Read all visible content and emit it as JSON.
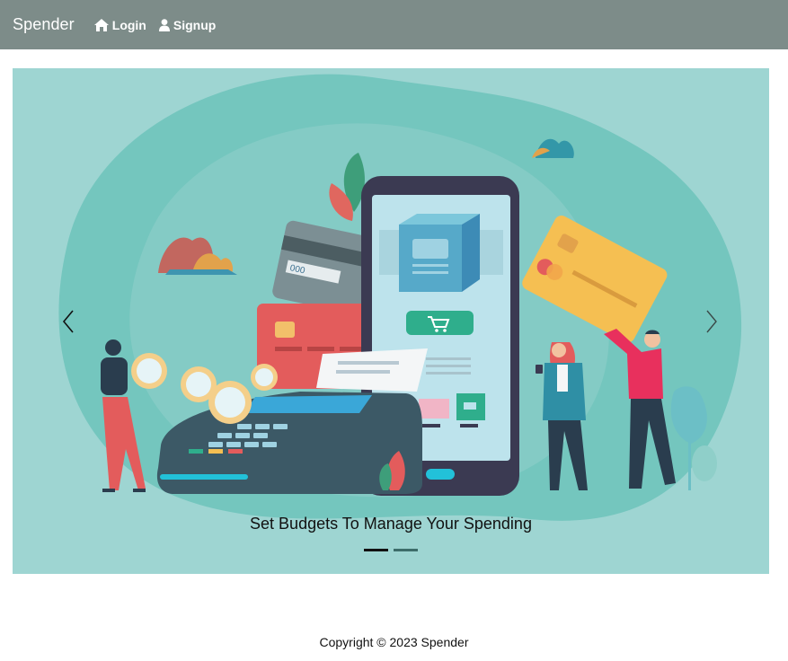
{
  "navbar": {
    "brand": "Spender",
    "links": [
      {
        "label": "Login",
        "icon": "home-icon"
      },
      {
        "label": "Signup",
        "icon": "user-icon"
      }
    ]
  },
  "carousel": {
    "caption": "Set Budgets To Manage Your Spending",
    "indicator_count": 2,
    "active_indicator": 1,
    "prev_icon": "chevron-left-icon",
    "next_icon": "chevron-right-icon"
  },
  "illustration_text": {
    "card_number": "000"
  },
  "footer": {
    "copyright": "Copyright © 2023 Spender"
  },
  "colors": {
    "navbar": "#7d8c89",
    "slide_background": "#9ed5d2"
  }
}
